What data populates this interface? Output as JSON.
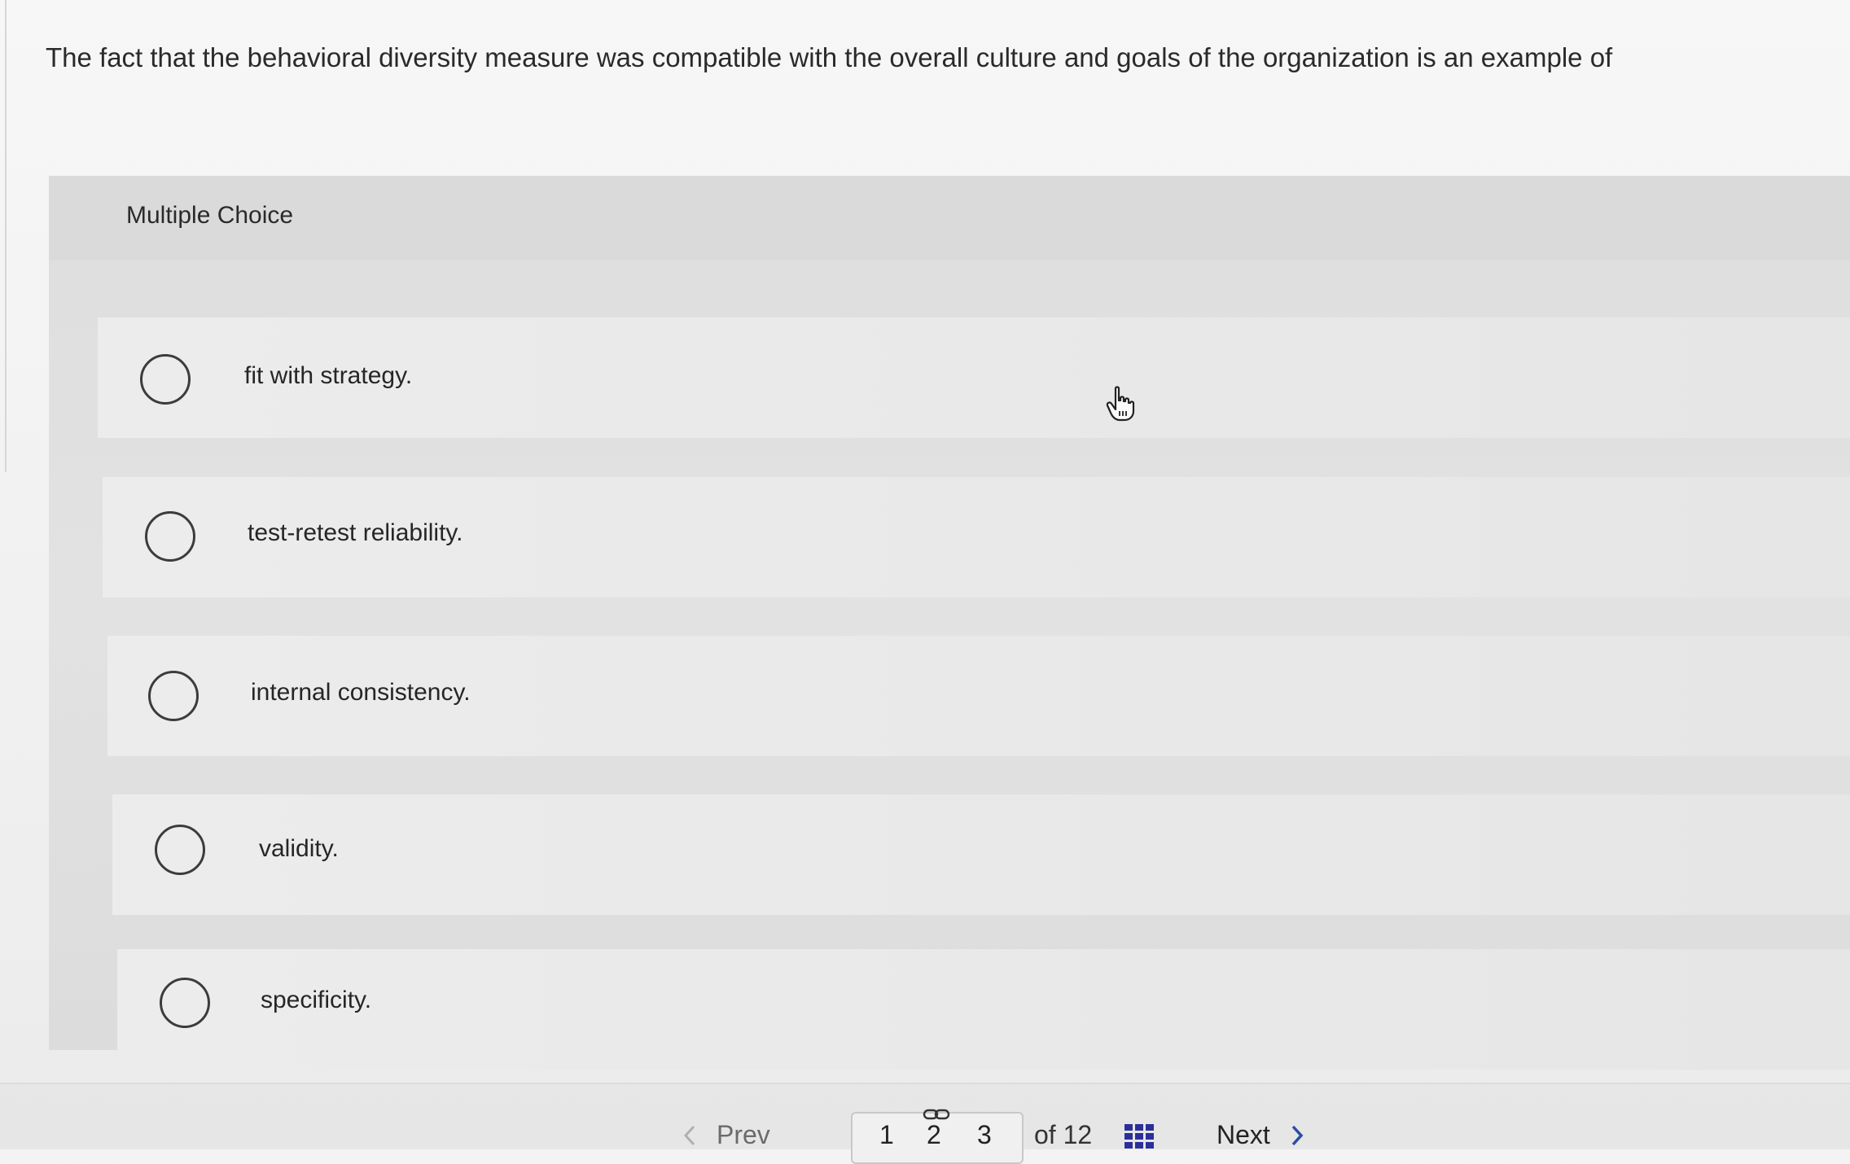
{
  "question": {
    "text": "The fact that the behavioral diversity measure was compatible with the overall culture and goals of the organization is an example of"
  },
  "choices": {
    "title": "Multiple Choice",
    "options": [
      {
        "label": "fit with strategy."
      },
      {
        "label": "test-retest reliability."
      },
      {
        "label": "internal consistency."
      },
      {
        "label": "validity."
      },
      {
        "label": "specificity."
      }
    ]
  },
  "pagination": {
    "prev_label": "Prev",
    "pages": [
      "1",
      "2",
      "3"
    ],
    "of_label": "of 12",
    "next_label": "Next"
  },
  "icons": {
    "cursor": "pointer-hand-icon",
    "prev": "chevron-left-icon",
    "next": "chevron-right-icon",
    "grid": "grid-icon",
    "link": "link-icon"
  },
  "colors": {
    "page_bg": "#efefef",
    "option_bg": "#eaeaea",
    "radio_border": "#3c3c3c",
    "grid_icon": "#2b2f9b",
    "next_chevron": "#2b4ea5"
  }
}
